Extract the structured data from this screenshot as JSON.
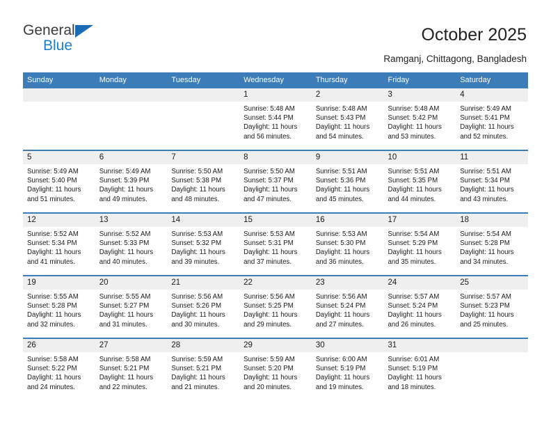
{
  "brand": {
    "name_part1": "General",
    "name_part2": "Blue",
    "triangle_color": "#1a6bb5",
    "blue_color": "#1a7fd4"
  },
  "header": {
    "title": "October 2025",
    "subtitle": "Ramganj, Chittagong, Bangladesh"
  },
  "colors": {
    "header_row": "#3c7cb8",
    "daynum_band": "#efefef",
    "grid_line": "#3c7cb8",
    "text": "#1a1a1a"
  },
  "weekdays": [
    "Sunday",
    "Monday",
    "Tuesday",
    "Wednesday",
    "Thursday",
    "Friday",
    "Saturday"
  ],
  "weeks": [
    [
      {
        "day": "",
        "lines": []
      },
      {
        "day": "",
        "lines": []
      },
      {
        "day": "",
        "lines": []
      },
      {
        "day": "1",
        "lines": [
          "Sunrise: 5:48 AM",
          "Sunset: 5:44 PM",
          "Daylight: 11 hours",
          "and 56 minutes."
        ]
      },
      {
        "day": "2",
        "lines": [
          "Sunrise: 5:48 AM",
          "Sunset: 5:43 PM",
          "Daylight: 11 hours",
          "and 54 minutes."
        ]
      },
      {
        "day": "3",
        "lines": [
          "Sunrise: 5:48 AM",
          "Sunset: 5:42 PM",
          "Daylight: 11 hours",
          "and 53 minutes."
        ]
      },
      {
        "day": "4",
        "lines": [
          "Sunrise: 5:49 AM",
          "Sunset: 5:41 PM",
          "Daylight: 11 hours",
          "and 52 minutes."
        ]
      }
    ],
    [
      {
        "day": "5",
        "lines": [
          "Sunrise: 5:49 AM",
          "Sunset: 5:40 PM",
          "Daylight: 11 hours",
          "and 51 minutes."
        ]
      },
      {
        "day": "6",
        "lines": [
          "Sunrise: 5:49 AM",
          "Sunset: 5:39 PM",
          "Daylight: 11 hours",
          "and 49 minutes."
        ]
      },
      {
        "day": "7",
        "lines": [
          "Sunrise: 5:50 AM",
          "Sunset: 5:38 PM",
          "Daylight: 11 hours",
          "and 48 minutes."
        ]
      },
      {
        "day": "8",
        "lines": [
          "Sunrise: 5:50 AM",
          "Sunset: 5:37 PM",
          "Daylight: 11 hours",
          "and 47 minutes."
        ]
      },
      {
        "day": "9",
        "lines": [
          "Sunrise: 5:51 AM",
          "Sunset: 5:36 PM",
          "Daylight: 11 hours",
          "and 45 minutes."
        ]
      },
      {
        "day": "10",
        "lines": [
          "Sunrise: 5:51 AM",
          "Sunset: 5:35 PM",
          "Daylight: 11 hours",
          "and 44 minutes."
        ]
      },
      {
        "day": "11",
        "lines": [
          "Sunrise: 5:51 AM",
          "Sunset: 5:34 PM",
          "Daylight: 11 hours",
          "and 43 minutes."
        ]
      }
    ],
    [
      {
        "day": "12",
        "lines": [
          "Sunrise: 5:52 AM",
          "Sunset: 5:34 PM",
          "Daylight: 11 hours",
          "and 41 minutes."
        ]
      },
      {
        "day": "13",
        "lines": [
          "Sunrise: 5:52 AM",
          "Sunset: 5:33 PM",
          "Daylight: 11 hours",
          "and 40 minutes."
        ]
      },
      {
        "day": "14",
        "lines": [
          "Sunrise: 5:53 AM",
          "Sunset: 5:32 PM",
          "Daylight: 11 hours",
          "and 39 minutes."
        ]
      },
      {
        "day": "15",
        "lines": [
          "Sunrise: 5:53 AM",
          "Sunset: 5:31 PM",
          "Daylight: 11 hours",
          "and 37 minutes."
        ]
      },
      {
        "day": "16",
        "lines": [
          "Sunrise: 5:53 AM",
          "Sunset: 5:30 PM",
          "Daylight: 11 hours",
          "and 36 minutes."
        ]
      },
      {
        "day": "17",
        "lines": [
          "Sunrise: 5:54 AM",
          "Sunset: 5:29 PM",
          "Daylight: 11 hours",
          "and 35 minutes."
        ]
      },
      {
        "day": "18",
        "lines": [
          "Sunrise: 5:54 AM",
          "Sunset: 5:28 PM",
          "Daylight: 11 hours",
          "and 34 minutes."
        ]
      }
    ],
    [
      {
        "day": "19",
        "lines": [
          "Sunrise: 5:55 AM",
          "Sunset: 5:28 PM",
          "Daylight: 11 hours",
          "and 32 minutes."
        ]
      },
      {
        "day": "20",
        "lines": [
          "Sunrise: 5:55 AM",
          "Sunset: 5:27 PM",
          "Daylight: 11 hours",
          "and 31 minutes."
        ]
      },
      {
        "day": "21",
        "lines": [
          "Sunrise: 5:56 AM",
          "Sunset: 5:26 PM",
          "Daylight: 11 hours",
          "and 30 minutes."
        ]
      },
      {
        "day": "22",
        "lines": [
          "Sunrise: 5:56 AM",
          "Sunset: 5:25 PM",
          "Daylight: 11 hours",
          "and 29 minutes."
        ]
      },
      {
        "day": "23",
        "lines": [
          "Sunrise: 5:56 AM",
          "Sunset: 5:24 PM",
          "Daylight: 11 hours",
          "and 27 minutes."
        ]
      },
      {
        "day": "24",
        "lines": [
          "Sunrise: 5:57 AM",
          "Sunset: 5:24 PM",
          "Daylight: 11 hours",
          "and 26 minutes."
        ]
      },
      {
        "day": "25",
        "lines": [
          "Sunrise: 5:57 AM",
          "Sunset: 5:23 PM",
          "Daylight: 11 hours",
          "and 25 minutes."
        ]
      }
    ],
    [
      {
        "day": "26",
        "lines": [
          "Sunrise: 5:58 AM",
          "Sunset: 5:22 PM",
          "Daylight: 11 hours",
          "and 24 minutes."
        ]
      },
      {
        "day": "27",
        "lines": [
          "Sunrise: 5:58 AM",
          "Sunset: 5:21 PM",
          "Daylight: 11 hours",
          "and 22 minutes."
        ]
      },
      {
        "day": "28",
        "lines": [
          "Sunrise: 5:59 AM",
          "Sunset: 5:21 PM",
          "Daylight: 11 hours",
          "and 21 minutes."
        ]
      },
      {
        "day": "29",
        "lines": [
          "Sunrise: 5:59 AM",
          "Sunset: 5:20 PM",
          "Daylight: 11 hours",
          "and 20 minutes."
        ]
      },
      {
        "day": "30",
        "lines": [
          "Sunrise: 6:00 AM",
          "Sunset: 5:19 PM",
          "Daylight: 11 hours",
          "and 19 minutes."
        ]
      },
      {
        "day": "31",
        "lines": [
          "Sunrise: 6:01 AM",
          "Sunset: 5:19 PM",
          "Daylight: 11 hours",
          "and 18 minutes."
        ]
      },
      {
        "day": "",
        "lines": []
      }
    ]
  ]
}
